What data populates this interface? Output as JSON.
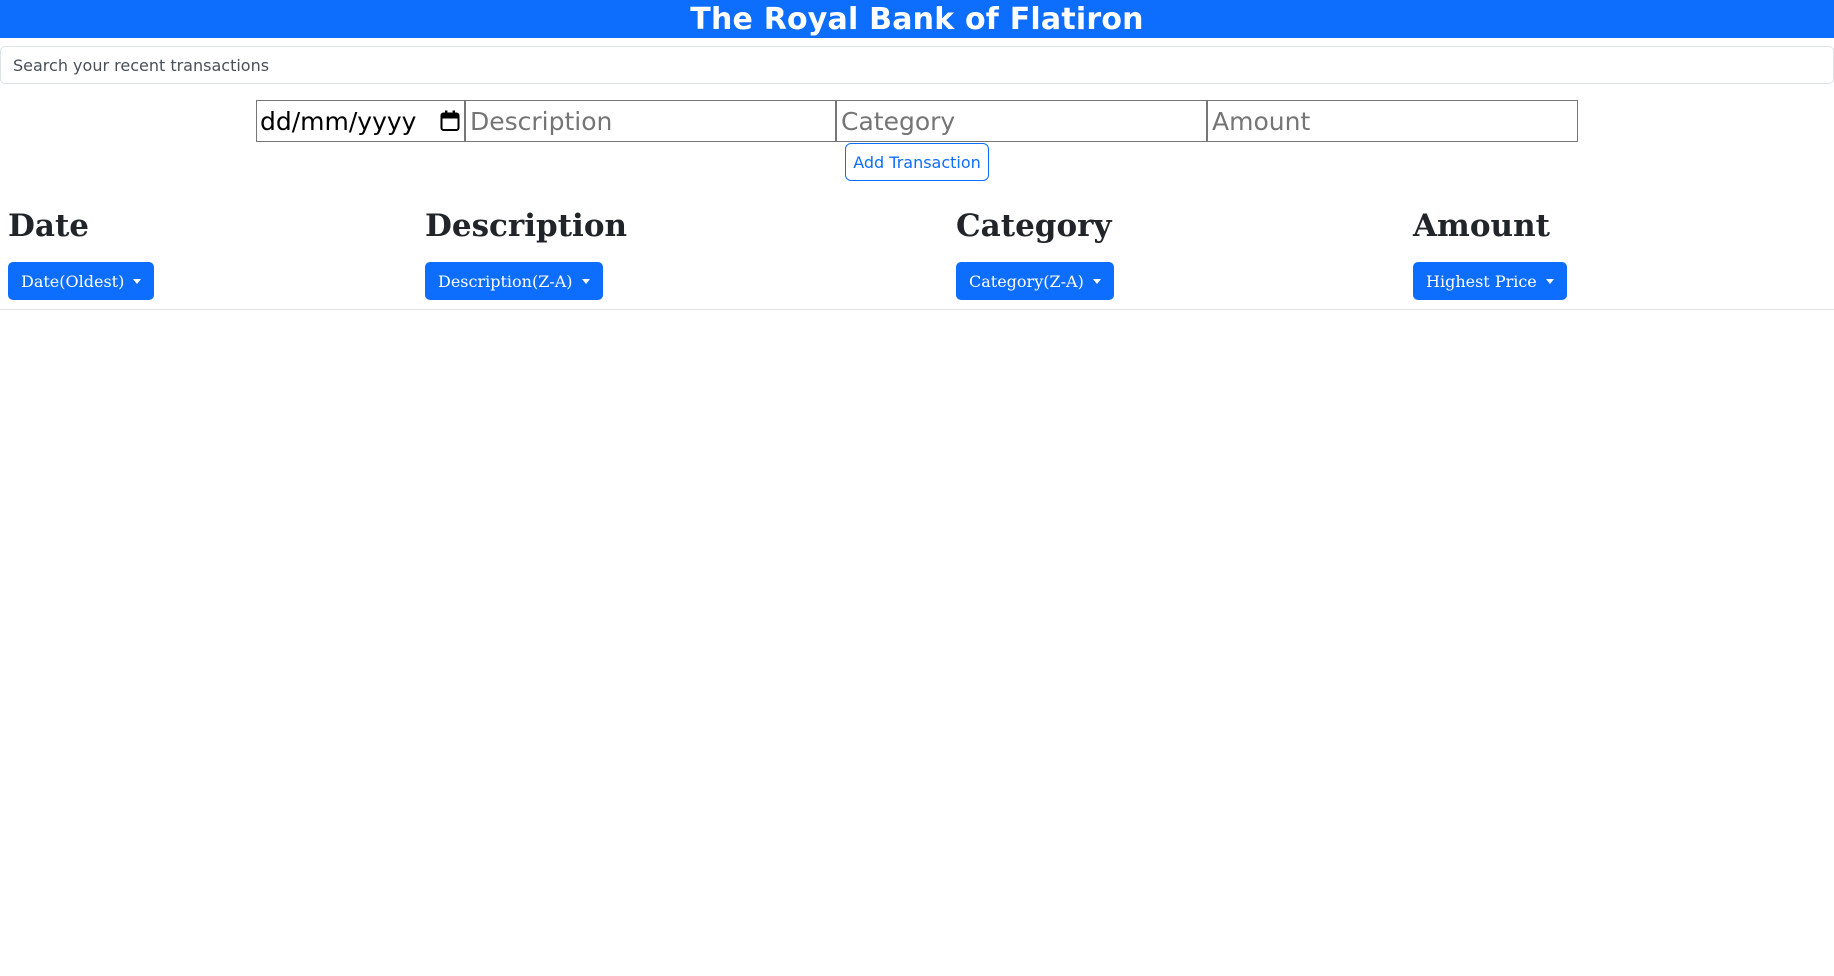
{
  "header": {
    "title": "The Royal Bank of Flatiron"
  },
  "search": {
    "placeholder": "Search your recent transactions",
    "value": ""
  },
  "form": {
    "date_placeholder": "dd/mm/yyyy",
    "description_placeholder": "Description",
    "category_placeholder": "Category",
    "amount_placeholder": "Amount",
    "submit_label": "Add Transaction"
  },
  "table": {
    "columns": [
      {
        "heading": "Date",
        "sort_label": "Date(Oldest)"
      },
      {
        "heading": "Description",
        "sort_label": "Description(Z-A)"
      },
      {
        "heading": "Category",
        "sort_label": "Category(Z-A)"
      },
      {
        "heading": "Amount",
        "sort_label": "Highest Price"
      }
    ],
    "rows": []
  },
  "icons": {
    "date_picker": "calendar-icon",
    "dropdown": "caret-down-icon"
  },
  "colors": {
    "primary": "#0d6efd",
    "text": "#212529",
    "border": "#dee2e6"
  }
}
